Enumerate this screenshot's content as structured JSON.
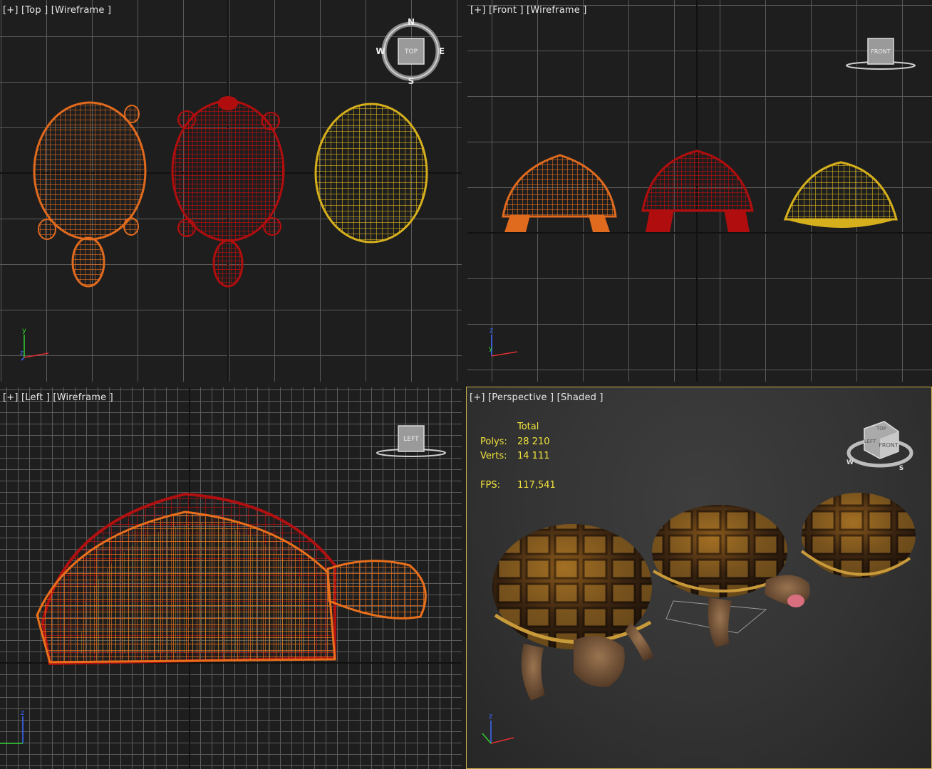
{
  "viewports": {
    "top": {
      "label": "[+] [Top ] [Wireframe ]",
      "gizmo": {
        "face": "TOP",
        "n": "N",
        "s": "S",
        "e": "E",
        "w": "W"
      },
      "axes": {
        "a": "y",
        "b": "z"
      }
    },
    "front": {
      "label": "[+] [Front ] [Wireframe ]",
      "gizmo": {
        "face": "FRONT"
      },
      "axes": {
        "a": "z",
        "b": "y"
      }
    },
    "left": {
      "label": "[+] [Left ] [Wireframe ]",
      "gizmo": {
        "face": "LEFT"
      },
      "axes": {
        "a": "z"
      }
    },
    "perspective": {
      "label": "[+] [Perspective ] [Shaded ]",
      "stats": {
        "header": "Total",
        "polys_label": "Polys:",
        "polys_value": "28 210",
        "verts_label": "Verts:",
        "verts_value": "14 111",
        "fps_label": "FPS:",
        "fps_value": "117,541"
      },
      "gizmo": {
        "face": "FRONT",
        "top_face": "TOP",
        "side_face": "LEFT",
        "w": "W",
        "s": "S"
      },
      "axes": {
        "a": "z"
      }
    }
  },
  "colors": {
    "wire_orange": "#e06a1e",
    "wire_red": "#b00e0e",
    "wire_yellow": "#d6b01c",
    "stats_text": "#f2e43c",
    "active_border": "#c9b04a"
  }
}
